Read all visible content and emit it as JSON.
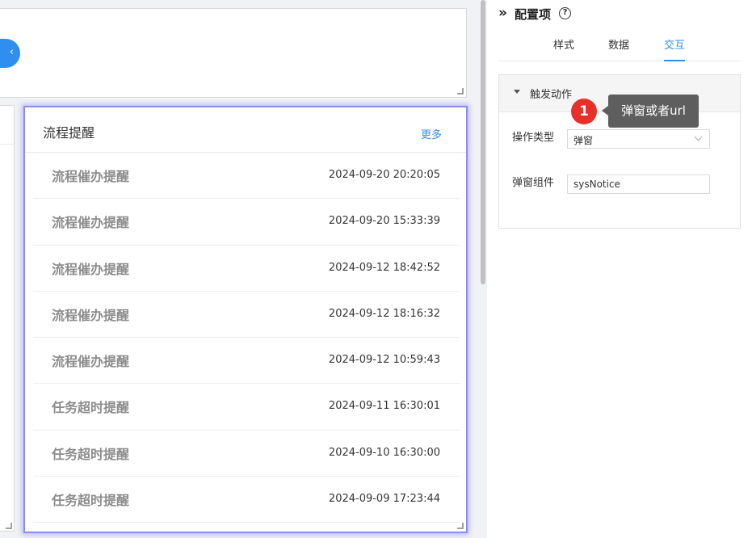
{
  "top_widget": {
    "button_glyph": "‹"
  },
  "flow_card": {
    "title": "流程提醒",
    "more_label": "更多",
    "rows": [
      {
        "title": "流程催办提醒",
        "time": "2024-09-20 20:20:05"
      },
      {
        "title": "流程催办提醒",
        "time": "2024-09-20 15:33:39"
      },
      {
        "title": "流程催办提醒",
        "time": "2024-09-12 18:42:52"
      },
      {
        "title": "流程催办提醒",
        "time": "2024-09-12 18:16:32"
      },
      {
        "title": "流程催办提醒",
        "time": "2024-09-12 10:59:43"
      },
      {
        "title": "任务超时提醒",
        "time": "2024-09-11 16:30:01"
      },
      {
        "title": "任务超时提醒",
        "time": "2024-09-10 16:30:00"
      },
      {
        "title": "任务超时提醒",
        "time": "2024-09-09 17:23:44"
      }
    ]
  },
  "config": {
    "collapse_glyph": "»",
    "title": "配置项",
    "help_glyph": "?",
    "tabs": [
      {
        "label": "样式",
        "active": false
      },
      {
        "label": "数据",
        "active": false
      },
      {
        "label": "交互",
        "active": true
      }
    ],
    "trigger": {
      "label": "触发动作",
      "action_type_label": "操作类型",
      "action_type_value": "弹窗",
      "popup_component_label": "弹窗组件",
      "popup_component_value": "sysNotice"
    }
  },
  "annotation": {
    "badge": "1",
    "text": "弹窗或者url"
  },
  "colors": {
    "accent": "#2f8ff0",
    "badge": "#e8302b",
    "tooltip": "#5e5e5e",
    "selected_border": "#8c8cf2"
  }
}
